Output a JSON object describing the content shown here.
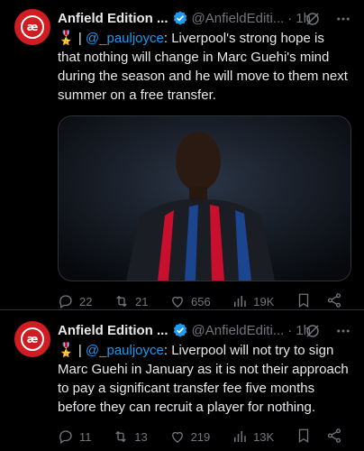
{
  "colors": {
    "accent": "#1d9bf0",
    "avatar_red": "#cf1d22",
    "muted": "#71767b"
  },
  "tweets": [
    {
      "name": "Anfield Edition ...",
      "handle": "@AnfieldEditi...",
      "dot": "·",
      "time": "1h",
      "medal": "🎖️",
      "separator": " | ",
      "mention": "@_pauljoyce",
      "body": ": Liverpool's strong hope is that nothing will change in Marc Guehi's mind during the season and he will move to them next summer on a free transfer.",
      "has_media": true,
      "metrics": {
        "replies": "22",
        "retweets": "21",
        "likes": "656",
        "views": "19K"
      }
    },
    {
      "name": "Anfield Edition ...",
      "handle": "@AnfieldEditi...",
      "dot": "·",
      "time": "1h",
      "medal": "🎖️",
      "separator": " | ",
      "mention": "@_pauljoyce",
      "body": ": Liverpool will not try to sign Marc Guehi in January as it is not their approach to pay a significant transfer fee five months before they can recruit a player for nothing.",
      "has_media": false,
      "metrics": {
        "replies": "11",
        "retweets": "13",
        "likes": "219",
        "views": "13K"
      }
    }
  ],
  "icons": {
    "avatar": "anfield-edition-logo",
    "verified": "verified-badge-icon",
    "grok": "grok-icon",
    "more": "more-icon",
    "reply": "reply-icon",
    "retweet": "retweet-icon",
    "like": "like-icon",
    "views": "views-icon",
    "bookmark": "bookmark-icon",
    "share": "share-icon"
  }
}
